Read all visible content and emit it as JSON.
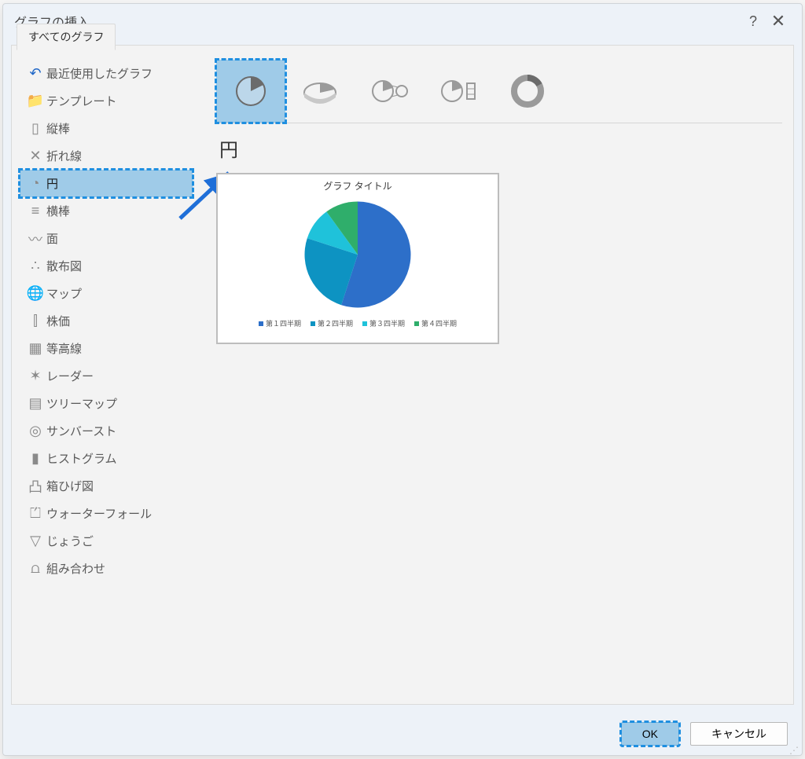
{
  "dialog": {
    "title": "グラフの挿入"
  },
  "tab": {
    "label": "すべてのグラフ"
  },
  "categories": [
    {
      "icon": "↶",
      "label": "最近使用したグラフ",
      "cls": "recent"
    },
    {
      "icon": "📁",
      "label": "テンプレート",
      "cls": "template"
    },
    {
      "icon": "▯",
      "label": "縦棒"
    },
    {
      "icon": "✕",
      "label": "折れ線"
    },
    {
      "icon": "◔",
      "label": "円",
      "selected": true,
      "highlighted": true
    },
    {
      "icon": "≡",
      "label": "横棒"
    },
    {
      "icon": "〰",
      "label": "面"
    },
    {
      "icon": "∴",
      "label": "散布図"
    },
    {
      "icon": "🌐",
      "label": "マップ"
    },
    {
      "icon": "⫿",
      "label": "株価"
    },
    {
      "icon": "▦",
      "label": "等高線"
    },
    {
      "icon": "✶",
      "label": "レーダー"
    },
    {
      "icon": "▤",
      "label": "ツリーマップ"
    },
    {
      "icon": "◎",
      "label": "サンバースト"
    },
    {
      "icon": "▮",
      "label": "ヒストグラム"
    },
    {
      "icon": "凸",
      "label": "箱ひげ図"
    },
    {
      "icon": "⏍",
      "label": "ウォーターフォール"
    },
    {
      "icon": "▽",
      "label": "じょうご"
    },
    {
      "icon": "⩍",
      "label": "組み合わせ"
    }
  ],
  "subtypes": {
    "items": [
      {
        "name": "pie",
        "selected": true,
        "highlighted": true
      },
      {
        "name": "3d-pie"
      },
      {
        "name": "pie-of-pie"
      },
      {
        "name": "bar-of-pie"
      },
      {
        "name": "doughnut"
      }
    ]
  },
  "section": {
    "title": "円"
  },
  "preview": {
    "title": "グラフ タイトル",
    "legend": [
      "第１四半期",
      "第２四半期",
      "第３四半期",
      "第４四半期"
    ]
  },
  "chart_data": {
    "type": "pie",
    "title": "グラフ タイトル",
    "categories": [
      "第１四半期",
      "第２四半期",
      "第３四半期",
      "第４四半期"
    ],
    "values": [
      55,
      25,
      10,
      10
    ],
    "colors": [
      "#2d6fc9",
      "#0d93c2",
      "#1fc2da",
      "#2fae6b"
    ]
  },
  "buttons": {
    "ok": "OK",
    "cancel": "キャンセル"
  }
}
